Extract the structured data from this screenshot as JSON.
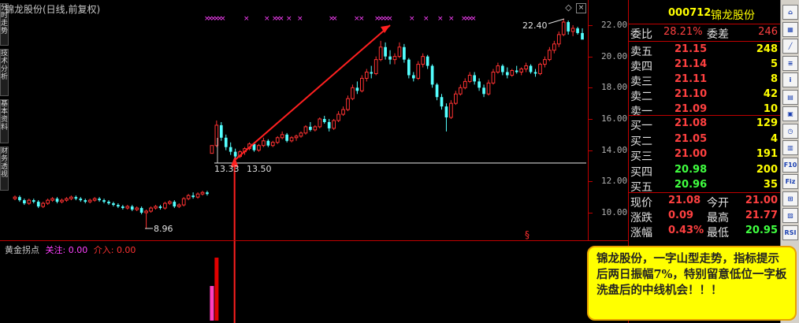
{
  "chart": {
    "title": "锦龙股份(日线,前复权)",
    "indicator_name": "黄金拐点",
    "indicator_focus_label": "关注:",
    "indicator_focus_value": "0.00",
    "indicator_entry_label": "介入:",
    "indicator_entry_value": "0.00",
    "price_labels": [
      "22.00",
      "20.00",
      "18.00",
      "16.00",
      "14.00",
      "12.00",
      "10.00"
    ],
    "annotations": {
      "high": "22.40",
      "low_left": "8.96",
      "low_mid_a": "13.33",
      "low_mid_b": "13.50",
      "section_mark": "§"
    },
    "left_tabs": [
      "分时走势",
      "技术分析",
      "基本资料",
      "财务透视"
    ],
    "top_marker_glyphs": "× ×"
  },
  "chart_data": {
    "type": "candlestick",
    "ylim": [
      9.5,
      22.5
    ],
    "grid": false,
    "candles": [
      [
        10.9,
        11.1,
        10.8,
        11.0
      ],
      [
        11.0,
        11.1,
        10.7,
        10.8
      ],
      [
        10.8,
        10.9,
        10.5,
        10.6
      ],
      [
        10.6,
        10.9,
        10.5,
        10.8
      ],
      [
        10.8,
        10.9,
        10.6,
        10.7
      ],
      [
        10.7,
        10.8,
        10.3,
        10.4
      ],
      [
        10.4,
        10.7,
        10.3,
        10.6
      ],
      [
        10.6,
        10.9,
        10.5,
        10.8
      ],
      [
        10.8,
        11.0,
        10.7,
        10.9
      ],
      [
        10.9,
        11.0,
        10.6,
        10.7
      ],
      [
        10.7,
        10.9,
        10.6,
        10.8
      ],
      [
        10.8,
        11.0,
        10.7,
        10.9
      ],
      [
        10.9,
        11.1,
        10.8,
        11.0
      ],
      [
        11.0,
        11.1,
        10.8,
        10.9
      ],
      [
        10.9,
        11.0,
        10.7,
        10.8
      ],
      [
        10.8,
        10.9,
        10.6,
        10.7
      ],
      [
        10.7,
        10.9,
        10.6,
        10.8
      ],
      [
        10.8,
        11.0,
        10.7,
        10.9
      ],
      [
        10.9,
        11.0,
        10.7,
        10.8
      ],
      [
        10.8,
        10.9,
        10.6,
        10.7
      ],
      [
        10.7,
        10.8,
        10.5,
        10.6
      ],
      [
        10.6,
        10.7,
        10.4,
        10.5
      ],
      [
        10.5,
        10.6,
        10.3,
        10.4
      ],
      [
        10.4,
        10.5,
        10.2,
        10.3
      ],
      [
        10.3,
        10.5,
        10.2,
        10.4
      ],
      [
        10.4,
        10.5,
        10.1,
        10.2
      ],
      [
        10.2,
        10.4,
        10.1,
        10.3
      ],
      [
        10.3,
        10.4,
        9.9,
        10.0
      ],
      [
        10.0,
        10.2,
        8.96,
        10.1
      ],
      [
        10.1,
        10.4,
        10.0,
        10.3
      ],
      [
        10.3,
        10.5,
        10.2,
        10.4
      ],
      [
        10.4,
        10.5,
        10.2,
        10.3
      ],
      [
        10.3,
        10.7,
        10.2,
        10.6
      ],
      [
        10.6,
        10.8,
        10.5,
        10.7
      ],
      [
        10.7,
        10.8,
        10.3,
        10.4
      ],
      [
        10.4,
        10.6,
        10.3,
        10.5
      ],
      [
        10.5,
        11.0,
        10.4,
        10.9
      ],
      [
        10.9,
        11.2,
        10.8,
        11.1
      ],
      [
        11.1,
        11.3,
        10.9,
        11.0
      ],
      [
        11.0,
        11.3,
        10.9,
        11.2
      ],
      [
        11.2,
        11.4,
        11.1,
        11.3
      ],
      [
        11.3,
        11.4,
        11.1,
        11.2
      ],
      [
        13.8,
        14.3,
        13.8,
        14.3
      ],
      [
        14.3,
        15.9,
        14.2,
        15.6
      ],
      [
        15.6,
        15.8,
        14.6,
        14.8
      ],
      [
        14.8,
        15.0,
        14.0,
        14.2
      ],
      [
        14.2,
        14.5,
        13.7,
        13.9
      ],
      [
        13.9,
        14.1,
        13.33,
        13.6
      ],
      [
        13.6,
        14.0,
        13.5,
        13.9
      ],
      [
        13.9,
        14.2,
        13.7,
        14.1
      ],
      [
        14.1,
        14.5,
        14.0,
        14.4
      ],
      [
        14.4,
        14.5,
        13.9,
        14.0
      ],
      [
        14.0,
        14.4,
        13.9,
        14.3
      ],
      [
        14.3,
        14.8,
        14.2,
        14.6
      ],
      [
        14.6,
        14.7,
        14.2,
        14.3
      ],
      [
        14.3,
        14.6,
        14.2,
        14.5
      ],
      [
        14.5,
        14.9,
        14.4,
        14.8
      ],
      [
        14.8,
        15.2,
        14.7,
        15.0
      ],
      [
        15.0,
        15.1,
        14.5,
        14.6
      ],
      [
        14.6,
        14.9,
        14.5,
        14.8
      ],
      [
        14.8,
        15.0,
        14.6,
        14.9
      ],
      [
        14.9,
        15.2,
        14.8,
        15.1
      ],
      [
        15.1,
        15.6,
        15.0,
        15.5
      ],
      [
        15.5,
        15.8,
        15.2,
        15.3
      ],
      [
        15.3,
        15.6,
        15.2,
        15.5
      ],
      [
        15.5,
        16.1,
        15.4,
        16.0
      ],
      [
        16.0,
        16.2,
        15.7,
        15.8
      ],
      [
        15.8,
        16.0,
        15.2,
        15.4
      ],
      [
        15.4,
        16.0,
        15.3,
        15.9
      ],
      [
        15.9,
        16.5,
        15.8,
        16.3
      ],
      [
        16.3,
        16.8,
        16.2,
        16.6
      ],
      [
        16.6,
        17.5,
        16.5,
        17.3
      ],
      [
        17.3,
        18.2,
        17.2,
        18.0
      ],
      [
        18.0,
        18.4,
        17.6,
        17.8
      ],
      [
        17.8,
        18.8,
        17.7,
        18.6
      ],
      [
        18.6,
        19.2,
        18.4,
        19.0
      ],
      [
        19.0,
        19.4,
        18.6,
        18.9
      ],
      [
        18.9,
        20.0,
        18.8,
        19.8
      ],
      [
        19.8,
        21.0,
        19.7,
        20.6
      ],
      [
        20.6,
        20.9,
        19.8,
        20.0
      ],
      [
        20.0,
        20.4,
        19.5,
        19.8
      ],
      [
        19.8,
        20.2,
        19.5,
        20.0
      ],
      [
        20.0,
        20.9,
        19.9,
        20.6
      ],
      [
        20.6,
        20.8,
        19.6,
        19.8
      ],
      [
        19.8,
        19.9,
        18.6,
        18.8
      ],
      [
        18.8,
        19.0,
        18.4,
        18.6
      ],
      [
        18.6,
        19.7,
        18.5,
        19.5
      ],
      [
        19.5,
        20.2,
        19.3,
        20.0
      ],
      [
        20.0,
        20.1,
        19.2,
        19.4
      ],
      [
        19.4,
        19.5,
        18.0,
        18.2
      ],
      [
        18.2,
        18.3,
        17.2,
        17.4
      ],
      [
        17.4,
        17.6,
        16.6,
        16.8
      ],
      [
        16.8,
        17.0,
        15.2,
        16.1
      ],
      [
        16.1,
        17.2,
        16.0,
        17.0
      ],
      [
        17.0,
        17.8,
        16.9,
        17.6
      ],
      [
        17.6,
        18.2,
        17.5,
        18.0
      ],
      [
        18.0,
        18.6,
        17.9,
        18.4
      ],
      [
        18.4,
        19.0,
        18.3,
        18.8
      ],
      [
        18.8,
        19.0,
        18.2,
        18.4
      ],
      [
        18.4,
        18.6,
        17.8,
        18.0
      ],
      [
        18.0,
        18.2,
        17.4,
        17.6
      ],
      [
        17.6,
        18.5,
        17.5,
        18.3
      ],
      [
        18.3,
        19.2,
        18.2,
        19.0
      ],
      [
        19.0,
        19.6,
        18.9,
        19.4
      ],
      [
        19.4,
        19.5,
        18.8,
        19.0
      ],
      [
        19.0,
        19.3,
        18.6,
        18.8
      ],
      [
        18.8,
        19.2,
        18.7,
        19.1
      ],
      [
        19.1,
        19.4,
        18.9,
        19.0
      ],
      [
        19.0,
        19.3,
        18.8,
        19.2
      ],
      [
        19.2,
        19.6,
        19.0,
        19.4
      ],
      [
        19.4,
        19.5,
        18.9,
        19.0
      ],
      [
        19.0,
        19.2,
        18.7,
        18.9
      ],
      [
        18.9,
        19.6,
        18.8,
        19.5
      ],
      [
        19.5,
        20.0,
        19.3,
        19.8
      ],
      [
        19.8,
        20.6,
        19.7,
        20.4
      ],
      [
        20.4,
        21.0,
        20.2,
        20.8
      ],
      [
        20.8,
        21.6,
        20.6,
        21.4
      ],
      [
        21.4,
        22.4,
        21.3,
        22.2
      ],
      [
        22.2,
        22.3,
        21.4,
        21.6
      ],
      [
        21.6,
        22.0,
        21.3,
        21.8
      ],
      [
        21.8,
        21.9,
        21.4,
        21.5
      ],
      [
        21.5,
        21.8,
        21.2,
        21.08
      ]
    ],
    "volumes": [
      0,
      0,
      0,
      0,
      0,
      0,
      0,
      0,
      0,
      0,
      0,
      0,
      0,
      0,
      0,
      0,
      0,
      0,
      0,
      0,
      0,
      0,
      0,
      0,
      0,
      0,
      0,
      0,
      0,
      0,
      0,
      0,
      0,
      0,
      0,
      0,
      0,
      0,
      0,
      0,
      0,
      0,
      0.55,
      1.0
    ],
    "trend_line_1": {
      "from": [
        47,
        13.4
      ],
      "to": [
        80,
        22.0
      ]
    },
    "trend_line_2": {
      "from": [
        47,
        13.5
      ],
      "to": [
        47,
        8.5
      ]
    }
  },
  "quote": {
    "code": "000712",
    "name": "锦龙股份",
    "ratio_label": "委比",
    "ratio_value": "28.21%",
    "diff_label": "委差",
    "diff_value": "246",
    "asks": [
      {
        "label": "卖五",
        "price": "21.15",
        "vol": "248"
      },
      {
        "label": "卖四",
        "price": "21.14",
        "vol": "5"
      },
      {
        "label": "卖三",
        "price": "21.11",
        "vol": "8"
      },
      {
        "label": "卖二",
        "price": "21.10",
        "vol": "42"
      },
      {
        "label": "卖一",
        "price": "21.09",
        "vol": "10"
      }
    ],
    "bids": [
      {
        "label": "买一",
        "price": "21.08",
        "vol": "129"
      },
      {
        "label": "买二",
        "price": "21.05",
        "vol": "4"
      },
      {
        "label": "买三",
        "price": "21.00",
        "vol": "191"
      },
      {
        "label": "买四",
        "price": "20.98",
        "vol": "200"
      },
      {
        "label": "买五",
        "price": "20.96",
        "vol": "35"
      }
    ],
    "stats": [
      {
        "l1": "现价",
        "v1": "21.08",
        "l2": "今开",
        "v2": "21.00",
        "c1": "#ff4040",
        "c2": "#ff4040"
      },
      {
        "l1": "涨跌",
        "v1": "0.09",
        "l2": "最高",
        "v2": "21.77",
        "c1": "#ff4040",
        "c2": "#ff4040"
      },
      {
        "l1": "涨幅",
        "v1": "0.43%",
        "l2": "最低",
        "v2": "20.95",
        "c1": "#ff4040",
        "c2": "#40ff40"
      }
    ]
  },
  "right_icons": [
    "home-icon",
    "chart-icon",
    "trend-icon",
    "list-icon",
    "info-icon",
    "grid-icon",
    "cal-icon",
    "clock-icon",
    "ddx-icon",
    "f10-icon",
    "fiz-icon",
    "sig-icon",
    "bs-icon",
    "rsi-icon"
  ],
  "right_icon_texts": [
    "",
    "",
    "",
    "",
    "",
    "",
    "",
    "",
    "",
    "F10",
    "Fiz",
    "",
    "",
    "RSI"
  ],
  "annotation_note": "锦龙股份，一字山型走势，指标提示后两日振幅7%，特别留意低位一字板洗盘后的中线机会！！！",
  "colors": {
    "up": "#ff3232",
    "down": "#54ffff",
    "frame": "#c00000",
    "note_bg": "#ffff00"
  }
}
